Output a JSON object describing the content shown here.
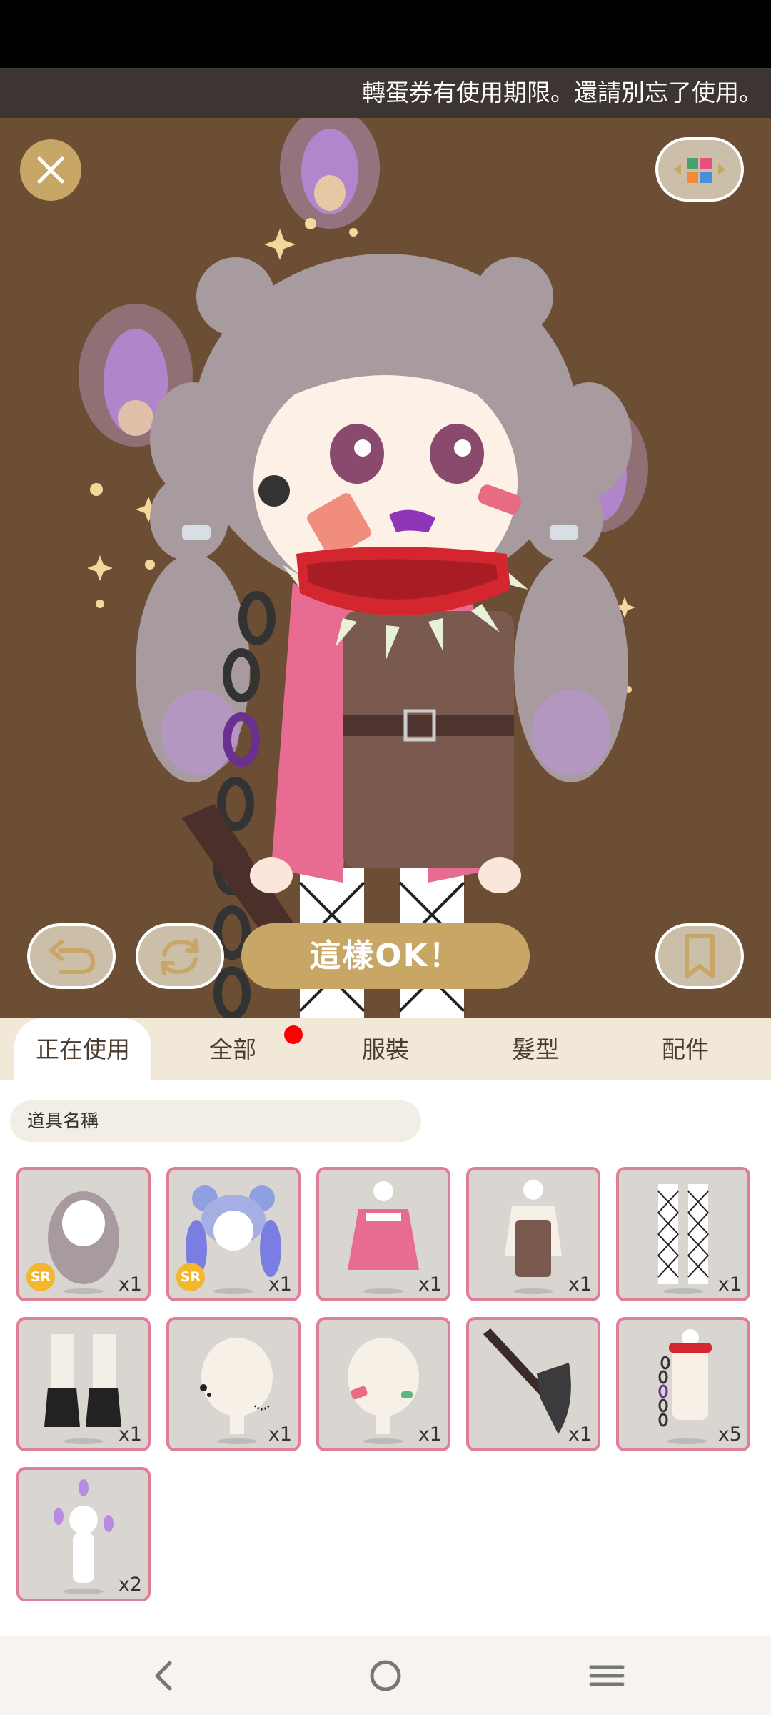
{
  "ticker": {
    "text": "轉蛋券有使用期限。還請別忘了使用。"
  },
  "stage": {
    "ok_label": "這樣OK！"
  },
  "tabs": [
    {
      "label": "正在使用",
      "active": true
    },
    {
      "label": "全部",
      "active": false,
      "badge": true
    },
    {
      "label": "服裝",
      "active": false
    },
    {
      "label": "髮型",
      "active": false
    },
    {
      "label": "配件",
      "active": false
    }
  ],
  "search": {
    "placeholder": "道具名稱"
  },
  "items": [
    {
      "name": "long-gray-hair",
      "count": "x1",
      "sr": "SR"
    },
    {
      "name": "blue-purple-braids",
      "count": "x1",
      "sr": "SR"
    },
    {
      "name": "pink-sweatshirt",
      "count": "x1"
    },
    {
      "name": "brown-overall-dress",
      "count": "x1"
    },
    {
      "name": "fishnet-tights",
      "count": "x1"
    },
    {
      "name": "black-boots",
      "count": "x1"
    },
    {
      "name": "ear-piercings",
      "count": "x1"
    },
    {
      "name": "face-bandages",
      "count": "x1"
    },
    {
      "name": "axe",
      "count": "x1"
    },
    {
      "name": "spiked-collar-chain",
      "count": "x5"
    },
    {
      "name": "purple-flames",
      "count": "x2"
    }
  ],
  "colors": {
    "accent": "#c8a766",
    "stage_bg": "#6b4e33",
    "item_border": "#df7f97",
    "tab_bar": "#f1e8d7"
  }
}
